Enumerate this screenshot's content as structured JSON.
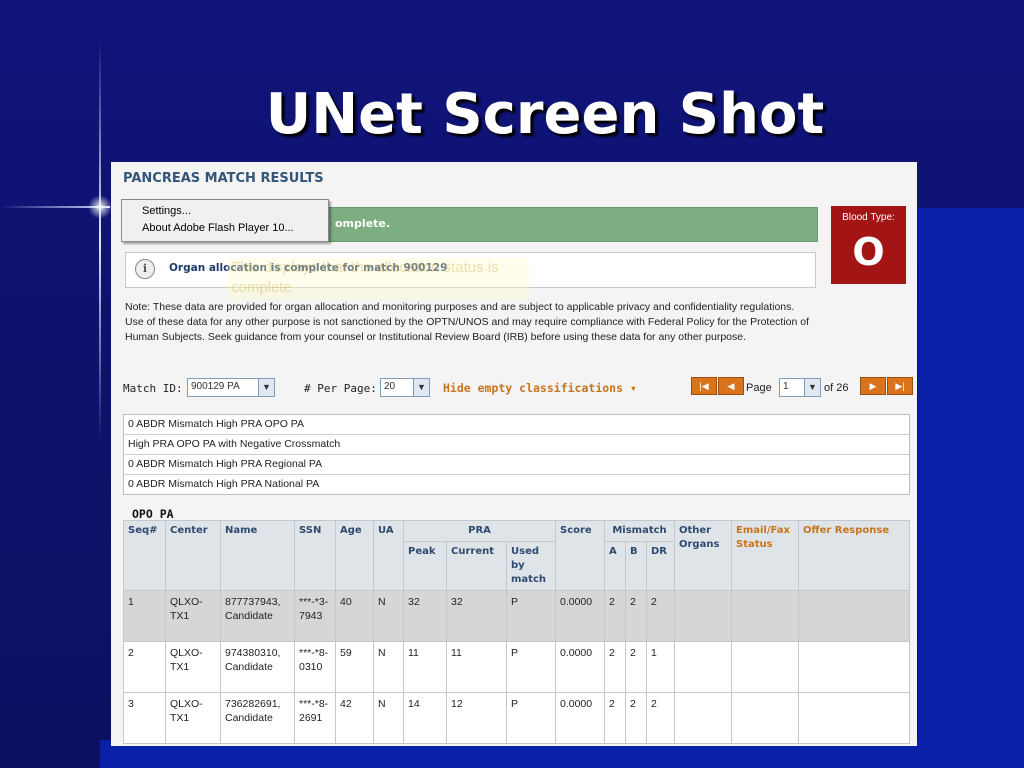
{
  "slide": {
    "title": "UNet Screen Shot"
  },
  "page": {
    "heading": "PANCREAS MATCH RESULTS",
    "status_banner": "omplete.",
    "context_menu": [
      "Settings...",
      "About Adobe Flash Player 10..."
    ],
    "blood_type": {
      "label": "Blood Type:",
      "value": "O"
    },
    "info_message": "Organ allocation is complete for match 900129",
    "tooltip_ghost": "This displays that the allocation status is complete",
    "note": "Note: These data are provided for organ allocation and monitoring purposes and are subject to applicable privacy and confidentiality regulations. Use of these data for any other purpose is not sanctioned by the OPTN/UNOS and may require compliance with Federal Policy for the Protection of Human Subjects. Seek guidance from your counsel or Institutional Review Board (IRB) before using these data for any other purpose.",
    "controls": {
      "match_id_label": "Match ID:",
      "match_id_value": "900129 PA",
      "per_page_label": "# Per Page:",
      "per_page_value": "20",
      "hide_empty_label": "Hide empty classifications ▾",
      "page_label": "Page",
      "page_value": "1",
      "page_total": "of 26"
    },
    "classifications": [
      "0 ABDR Mismatch High PRA OPO PA",
      "High PRA OPO PA with Negative Crossmatch",
      "0 ABDR Mismatch High PRA Regional PA",
      "0 ABDR Mismatch High PRA National PA"
    ],
    "section_label": "OPO PA",
    "table": {
      "group_headers": {
        "pra": "PRA",
        "mismatch": "Mismatch"
      },
      "headers": {
        "seq": "Seq#",
        "center": "Center",
        "name": "Name",
        "ssn": "SSN",
        "age": "Age",
        "ua": "UA",
        "peak": "Peak",
        "current": "Current",
        "used": "Used by match",
        "score": "Score",
        "a": "A",
        "b": "B",
        "dr": "DR",
        "other": "Other Organs",
        "email": "Email/Fax Status",
        "offer": "Offer Response"
      },
      "rows": [
        {
          "seq": "1",
          "center": "QLXO-TX1",
          "name": "877737943, Candidate",
          "ssn": "***-*3-7943",
          "age": "40",
          "ua": "N",
          "peak": "32",
          "current": "32",
          "used": "P",
          "score": "0.0000",
          "a": "2",
          "b": "2",
          "dr": "2",
          "other": "",
          "email": "",
          "offer": ""
        },
        {
          "seq": "2",
          "center": "QLXO-TX1",
          "name": "974380310, Candidate",
          "ssn": "***-*8-0310",
          "age": "59",
          "ua": "N",
          "peak": "11",
          "current": "11",
          "used": "P",
          "score": "0.0000",
          "a": "2",
          "b": "2",
          "dr": "1",
          "other": "",
          "email": "",
          "offer": ""
        },
        {
          "seq": "3",
          "center": "QLXO-TX1",
          "name": "736282691, Candidate",
          "ssn": "***-*8-2691",
          "age": "42",
          "ua": "N",
          "peak": "14",
          "current": "12",
          "used": "P",
          "score": "0.0000",
          "a": "2",
          "b": "2",
          "dr": "2",
          "other": "",
          "email": "",
          "offer": ""
        }
      ]
    }
  }
}
